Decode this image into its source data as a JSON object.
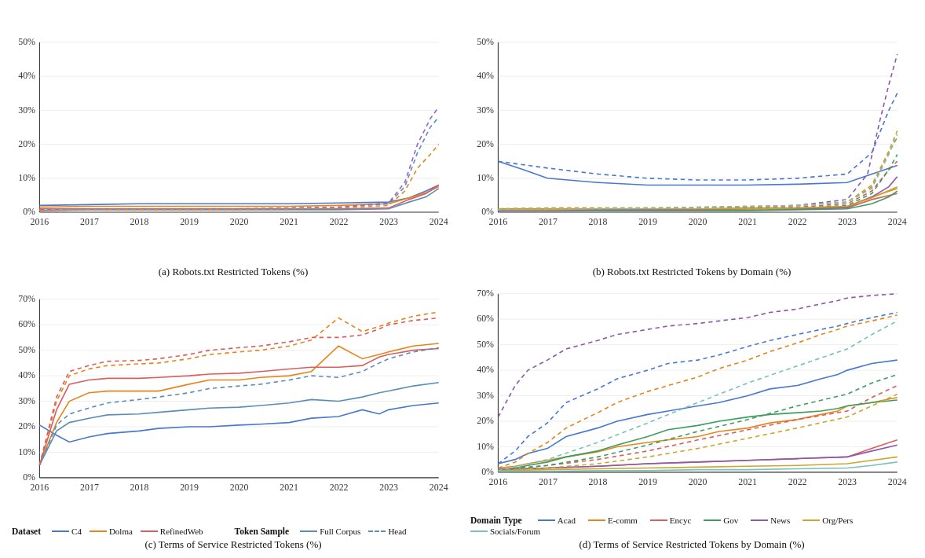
{
  "charts": [
    {
      "id": "chart-a",
      "caption": "(a) Robots.txt Restricted Tokens (%)",
      "yMax": 50,
      "yTicks": [
        0,
        10,
        20,
        30,
        40,
        50
      ],
      "xTicks": [
        "2016",
        "2017",
        "2018",
        "2019",
        "2020",
        "2021",
        "2022",
        "2023",
        "2024"
      ]
    },
    {
      "id": "chart-b",
      "caption": "(b) Robots.txt Restricted Tokens by Domain (%)",
      "yMax": 50,
      "yTicks": [
        0,
        10,
        20,
        30,
        40,
        50
      ],
      "xTicks": [
        "2016",
        "2017",
        "2018",
        "2019",
        "2020",
        "2021",
        "2022",
        "2023",
        "2024"
      ]
    },
    {
      "id": "chart-c",
      "caption": "(c) Terms of Service Restricted Tokens (%)",
      "yMax": 70,
      "yTicks": [
        0,
        10,
        20,
        30,
        40,
        50,
        60,
        70
      ],
      "xTicks": [
        "2016",
        "2017",
        "2018",
        "2019",
        "2020",
        "2021",
        "2022",
        "2023",
        "2024"
      ]
    },
    {
      "id": "chart-d",
      "caption": "(d) Terms of Service Restricted Tokens by Domain (%)",
      "yMax": 70,
      "yTicks": [
        0,
        10,
        20,
        30,
        40,
        50,
        60,
        70
      ],
      "xTicks": [
        "2016",
        "2017",
        "2018",
        "2019",
        "2020",
        "2021",
        "2022",
        "2023",
        "2024"
      ]
    }
  ],
  "legend_c": {
    "dataset_title": "Dataset",
    "token_title": "Token Sample",
    "items": [
      {
        "label": "C4",
        "color": "#4878CF",
        "dashed": false
      },
      {
        "label": "Dolma",
        "color": "#E8851A",
        "dashed": false
      },
      {
        "label": "RefinedWeb",
        "color": "#D95F5F",
        "dashed": false
      },
      {
        "label": "Full Corpus",
        "color": "#5B8DB8",
        "dashed": false
      },
      {
        "label": "Head",
        "color": "#5B8DB8",
        "dashed": true
      }
    ]
  },
  "legend_d": {
    "domain_title": "Domain Type",
    "items": [
      {
        "label": "Acad",
        "color": "#4878CF"
      },
      {
        "label": "E-comm",
        "color": "#E8851A"
      },
      {
        "label": "Encyc",
        "color": "#D95F5F"
      },
      {
        "label": "Gov",
        "color": "#3A9E5F"
      },
      {
        "label": "News",
        "color": "#8B5AA8"
      },
      {
        "label": "Org/Pers",
        "color": "#C9A82C"
      },
      {
        "label": "Socials/Forum",
        "color": "#7BBFBF"
      }
    ]
  }
}
